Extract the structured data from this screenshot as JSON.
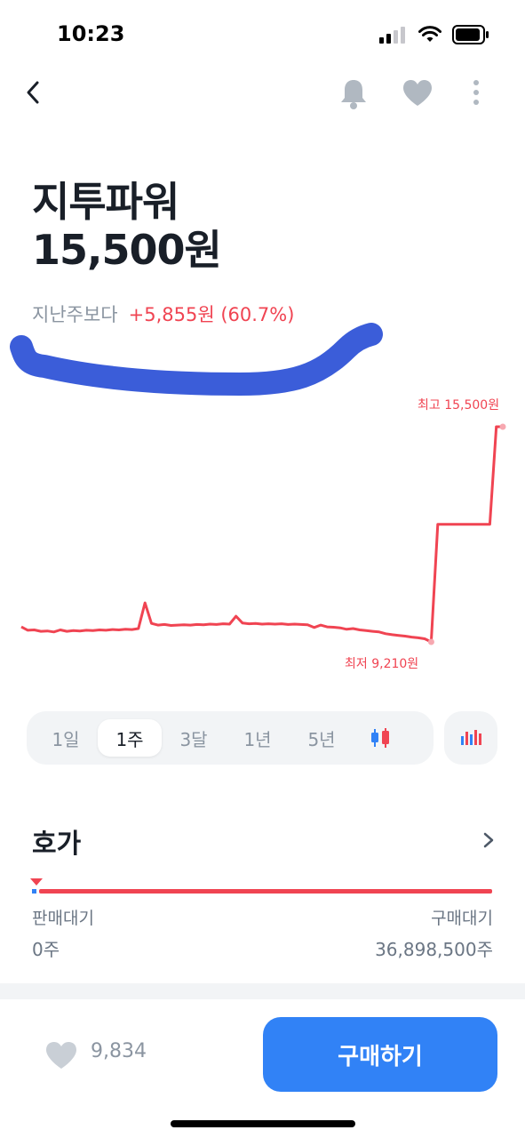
{
  "status_bar": {
    "time": "10:23"
  },
  "nav": {
    "icons": [
      "chevron-left-icon",
      "bell-icon",
      "heart-icon",
      "more-vertical-icon"
    ]
  },
  "stock": {
    "name": "지투파워",
    "price": "15,500원",
    "change_label": "지난주보다",
    "change_value": "+5,855원 (60.7%)"
  },
  "chart": {
    "high_label": "최고 15,500원",
    "low_label": "최저 9,210원",
    "line_color": "#f04452"
  },
  "chart_data": {
    "type": "line",
    "title": "",
    "series": [
      {
        "values": [
          9650,
          9550,
          9560,
          9520,
          9530,
          9500,
          9560,
          9520,
          9540,
          9530,
          9550,
          9540,
          9560,
          9550,
          9570,
          9560,
          9580,
          9570,
          9600,
          10350,
          9750,
          9700,
          9720,
          9690,
          9700,
          9710,
          9700,
          9720,
          9710,
          9730,
          9720,
          9740,
          9730,
          9960,
          9760,
          9740,
          9750,
          9730,
          9740,
          9730,
          9740,
          9720,
          9730,
          9720,
          9710,
          9630,
          9700,
          9650,
          9640,
          9620,
          9580,
          9600,
          9560,
          9540,
          9520,
          9500,
          9450,
          9420,
          9400,
          9380,
          9350,
          9330,
          9300,
          9210,
          12650,
          12650,
          12650,
          12650,
          12650,
          12650,
          12650,
          12650,
          12650,
          15500,
          15500
        ]
      }
    ],
    "high": 15500,
    "low": 9210,
    "period": "1주"
  },
  "period_selector": {
    "options": [
      "1일",
      "1주",
      "3달",
      "1년",
      "5년"
    ],
    "selected": "1주"
  },
  "order_book": {
    "title": "호가",
    "sell_label": "판매대기",
    "buy_label": "구매대기",
    "sell_value": "0주",
    "buy_value": "36,898,500주",
    "sell_color": "#3182f6",
    "buy_color": "#f04452"
  },
  "bottom": {
    "like_count": "9,834",
    "buy_button": "구매하기",
    "accent": "#3182f6"
  }
}
